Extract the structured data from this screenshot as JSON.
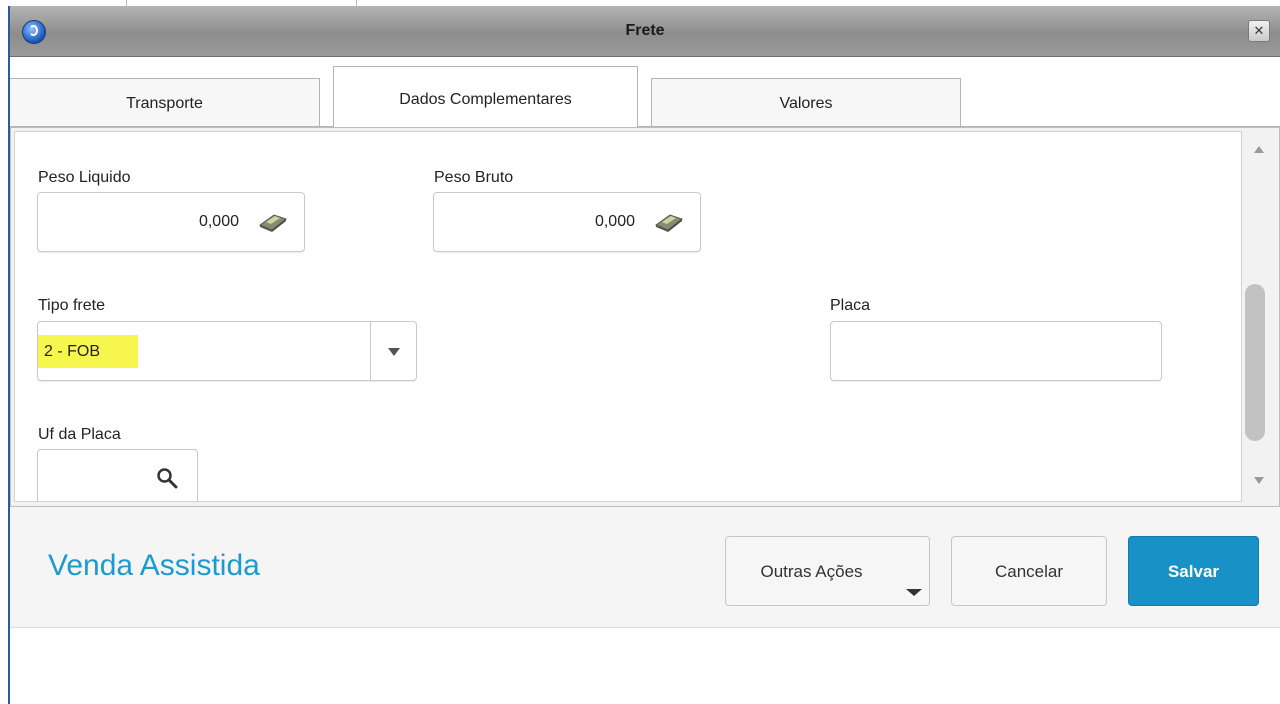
{
  "window": {
    "title": "Frete"
  },
  "tabs": [
    {
      "label": "Transporte",
      "active": false
    },
    {
      "label": "Dados Complementares",
      "active": true
    },
    {
      "label": "Valores",
      "active": false
    }
  ],
  "form": {
    "peso_liquido": {
      "label": "Peso Liquido",
      "value": "0,000",
      "icon": "calculator-icon"
    },
    "peso_bruto": {
      "label": "Peso Bruto",
      "value": "0,000",
      "icon": "calculator-icon"
    },
    "tipo_frete": {
      "label": "Tipo frete",
      "selected": "2 - FOB"
    },
    "placa": {
      "label": "Placa",
      "value": ""
    },
    "uf_placa": {
      "label": "Uf da Placa",
      "value": "",
      "icon": "search-icon"
    }
  },
  "footer": {
    "title": "Venda Assistida",
    "buttons": {
      "outras_acoes": "Outras Ações",
      "cancelar": "Cancelar",
      "salvar": "Salvar"
    }
  },
  "colors": {
    "brand_text": "#1b9bd0",
    "primary_button": "#1791c6",
    "highlight": "#f6f64f"
  }
}
